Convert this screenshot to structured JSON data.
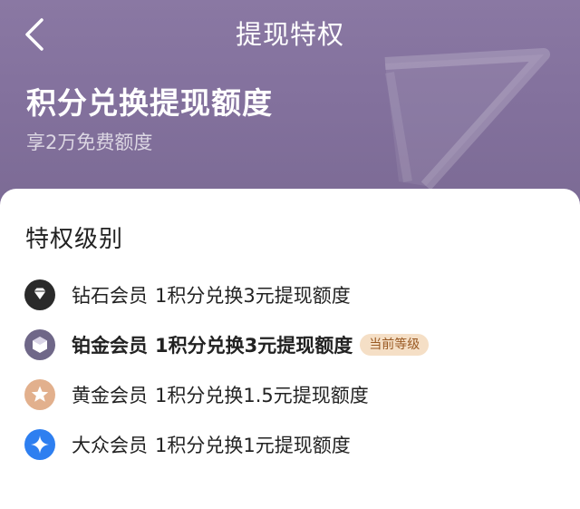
{
  "nav": {
    "title": "提现特权"
  },
  "hero": {
    "title": "积分兑换提现额度",
    "subtitle": "享2万免费额度"
  },
  "section": {
    "title": "特权级别"
  },
  "tiers": [
    {
      "name": "钻石会员",
      "desc": "1积分兑换3元提现额度",
      "icon": "diamond-icon",
      "color": "#2a2a2a"
    },
    {
      "name": "铂金会员",
      "desc": "1积分兑换3元提现额度",
      "icon": "platinum-gem-icon",
      "color": "#6f6788",
      "badge": "当前等级"
    },
    {
      "name": "黄金会员",
      "desc": "1积分兑换1.5元提现额度",
      "icon": "gold-star-icon",
      "color": "#e2b08d"
    },
    {
      "name": "大众会员",
      "desc": "1积分兑换1元提现额度",
      "icon": "sparkle-icon",
      "color": "#2e7ff0"
    }
  ],
  "colors": {
    "header_bg": "#83719d",
    "badge_bg": "#f5dfc6",
    "badge_text": "#9a5a24"
  }
}
